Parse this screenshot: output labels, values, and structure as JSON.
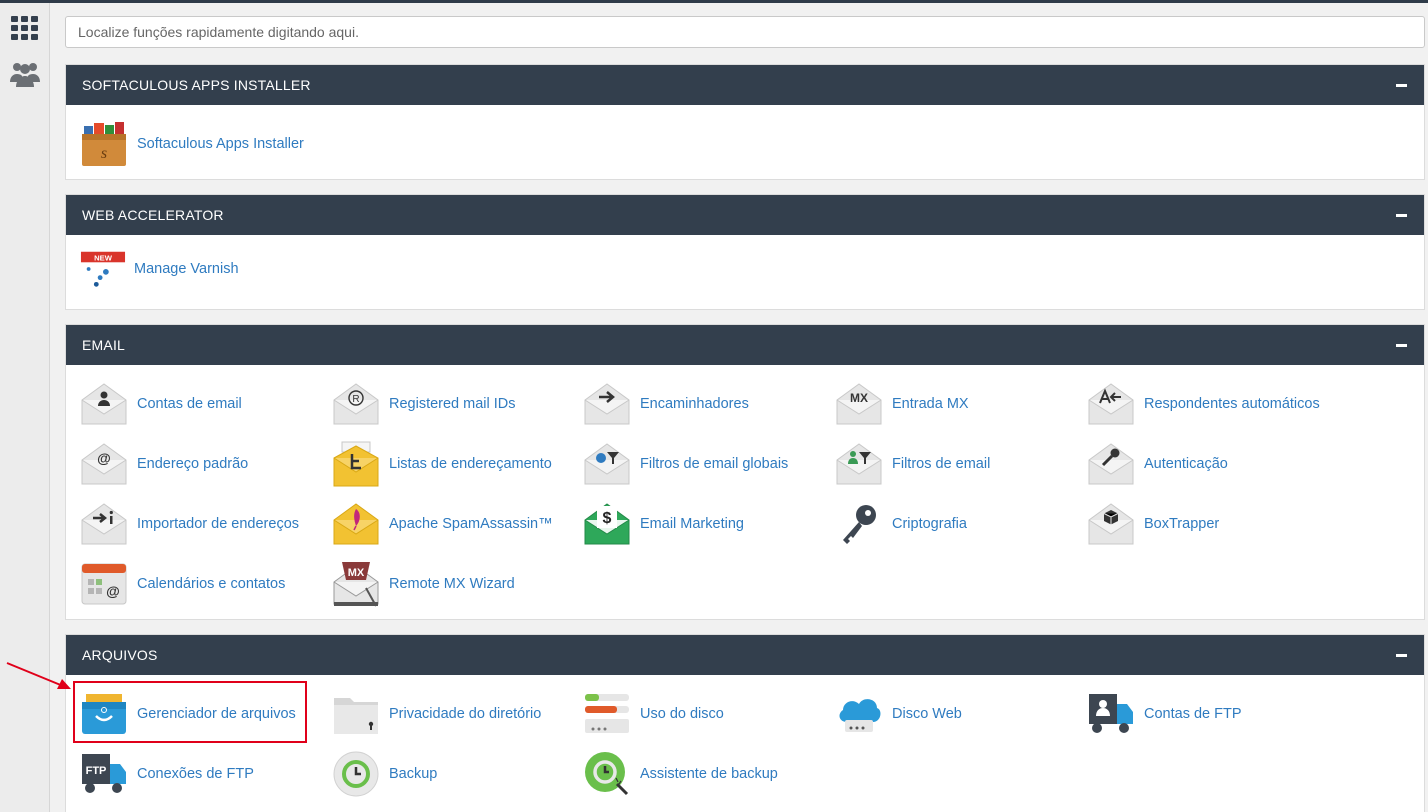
{
  "search": {
    "placeholder": "Localize funções rapidamente digitando aqui."
  },
  "sidebar": {
    "icons": [
      "grid-icon",
      "users-icon"
    ]
  },
  "sections": [
    {
      "title": "SOFTACULOUS APPS INSTALLER",
      "items": [
        {
          "label": "Softaculous Apps Installer",
          "icon": "softaculous-icon"
        }
      ]
    },
    {
      "title": "WEB ACCELERATOR",
      "items": [
        {
          "label": "Manage Varnish",
          "icon": "varnish-icon",
          "badge": "NEW"
        }
      ]
    },
    {
      "title": "EMAIL",
      "items": [
        {
          "label": "Contas de email",
          "icon": "email-accounts-icon"
        },
        {
          "label": "Registered mail IDs",
          "icon": "registered-mail-icon"
        },
        {
          "label": "Encaminhadores",
          "icon": "forwarders-icon"
        },
        {
          "label": "Entrada MX",
          "icon": "mx-entry-icon"
        },
        {
          "label": "Respondentes automáticos",
          "icon": "autoresponders-icon"
        },
        {
          "label": "Endereço padrão",
          "icon": "default-address-icon"
        },
        {
          "label": "Listas de endereçamento",
          "icon": "mailing-lists-icon"
        },
        {
          "label": "Filtros de email globais",
          "icon": "global-filters-icon"
        },
        {
          "label": "Filtros de email",
          "icon": "email-filters-icon"
        },
        {
          "label": "Autenticação",
          "icon": "authentication-icon"
        },
        {
          "label": "Importador de endereços",
          "icon": "address-importer-icon"
        },
        {
          "label": "Apache SpamAssassin™",
          "icon": "spamassassin-icon"
        },
        {
          "label": "Email Marketing",
          "icon": "email-marketing-icon"
        },
        {
          "label": "Criptografia",
          "icon": "encryption-key-icon"
        },
        {
          "label": "BoxTrapper",
          "icon": "boxtrapper-icon"
        },
        {
          "label": "Calendários e contatos",
          "icon": "calendars-contacts-icon"
        },
        {
          "label": "Remote MX Wizard",
          "icon": "remote-mx-wizard-icon"
        }
      ]
    },
    {
      "title": "ARQUIVOS",
      "items": [
        {
          "label": "Gerenciador de arquivos",
          "icon": "file-manager-icon"
        },
        {
          "label": "Privacidade do diretório",
          "icon": "directory-privacy-icon"
        },
        {
          "label": "Uso do disco",
          "icon": "disk-usage-icon"
        },
        {
          "label": "Disco Web",
          "icon": "web-disk-icon"
        },
        {
          "label": "Contas de FTP",
          "icon": "ftp-accounts-icon"
        },
        {
          "label": "Conexões de FTP",
          "icon": "ftp-connections-icon"
        },
        {
          "label": "Backup",
          "icon": "backup-icon"
        },
        {
          "label": "Assistente de backup",
          "icon": "backup-wizard-icon"
        }
      ]
    }
  ],
  "badges": {
    "new": "NEW",
    "mx": "MX",
    "ftp": "FTP",
    "mx_wizard": "MX"
  },
  "colors": {
    "header": "#333f4d",
    "link": "#2f7bc0",
    "highlight": "#e0001a"
  }
}
